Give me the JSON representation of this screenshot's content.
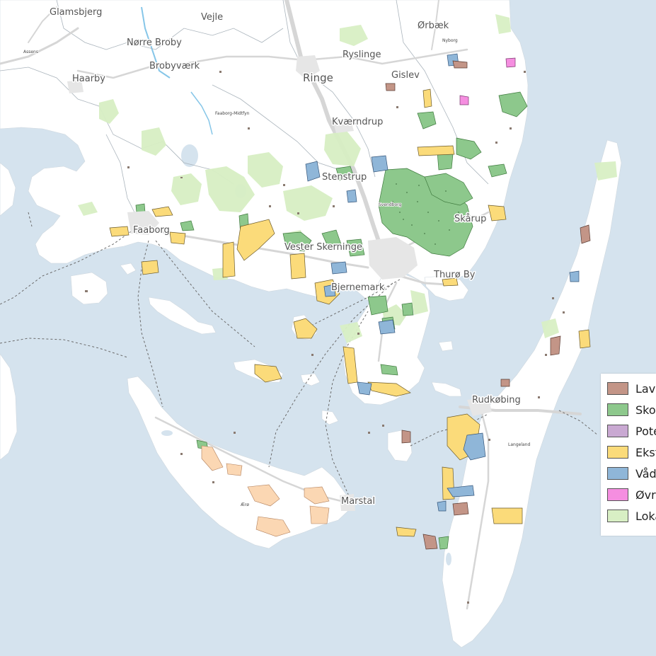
{
  "map": {
    "colors": {
      "water": "#d5e3ee",
      "land": "#ffffff",
      "lavbund": "#c39587",
      "skov": "#8dc88c",
      "potentiel": "#c9a9d2",
      "ekstensiv": "#fbdb7a",
      "vaad": "#8fb6d8",
      "oevrige": "#f58ee0",
      "lokal": "#d8efc4",
      "peach": "#fbd7b3"
    },
    "places": {
      "glamsbjerg": "Glamsbjerg",
      "vejle": "Vejle",
      "orbaek": "Ørbæk",
      "norre_broby": "Nørre Broby",
      "brobyvaerk": "Brobyværk",
      "ryslinge": "Ryslinge",
      "ringe": "Ringe",
      "gislev": "Gislev",
      "haarby": "Haarby",
      "kvaerndrup": "Kværndrup",
      "stenstrup": "Stenstrup",
      "faaborg": "Faaborg",
      "skaarup": "Skårup",
      "vester_skerninge": "Vester Skerninge",
      "thuro_by": "Thurø By",
      "tasinge": "Bjernemark",
      "rudkobing": "Rudkøbing",
      "marstal": "Marstal",
      "langeland_small": "Langeland",
      "assens_small": "Assens",
      "nyborg_small": "Nyborg",
      "faaborg_midtfyn_small": "Faaborg-Midtfyn",
      "svendborg_small": "Svendborg",
      "aero_small": "Ærø"
    }
  },
  "legend": {
    "items": [
      {
        "label": "Lavbund",
        "color": "#c39587"
      },
      {
        "label": "Skov",
        "color": "#8dc88c"
      },
      {
        "label": "Potentiel",
        "color": "#c9a9d2"
      },
      {
        "label": "Ekstensiv",
        "color": "#fbdb7a"
      },
      {
        "label": "Vådområde",
        "color": "#8fb6d8"
      },
      {
        "label": "Øvrige",
        "color": "#f58ee0"
      },
      {
        "label": "Lokalplan",
        "color": "#d8efc4"
      }
    ]
  }
}
